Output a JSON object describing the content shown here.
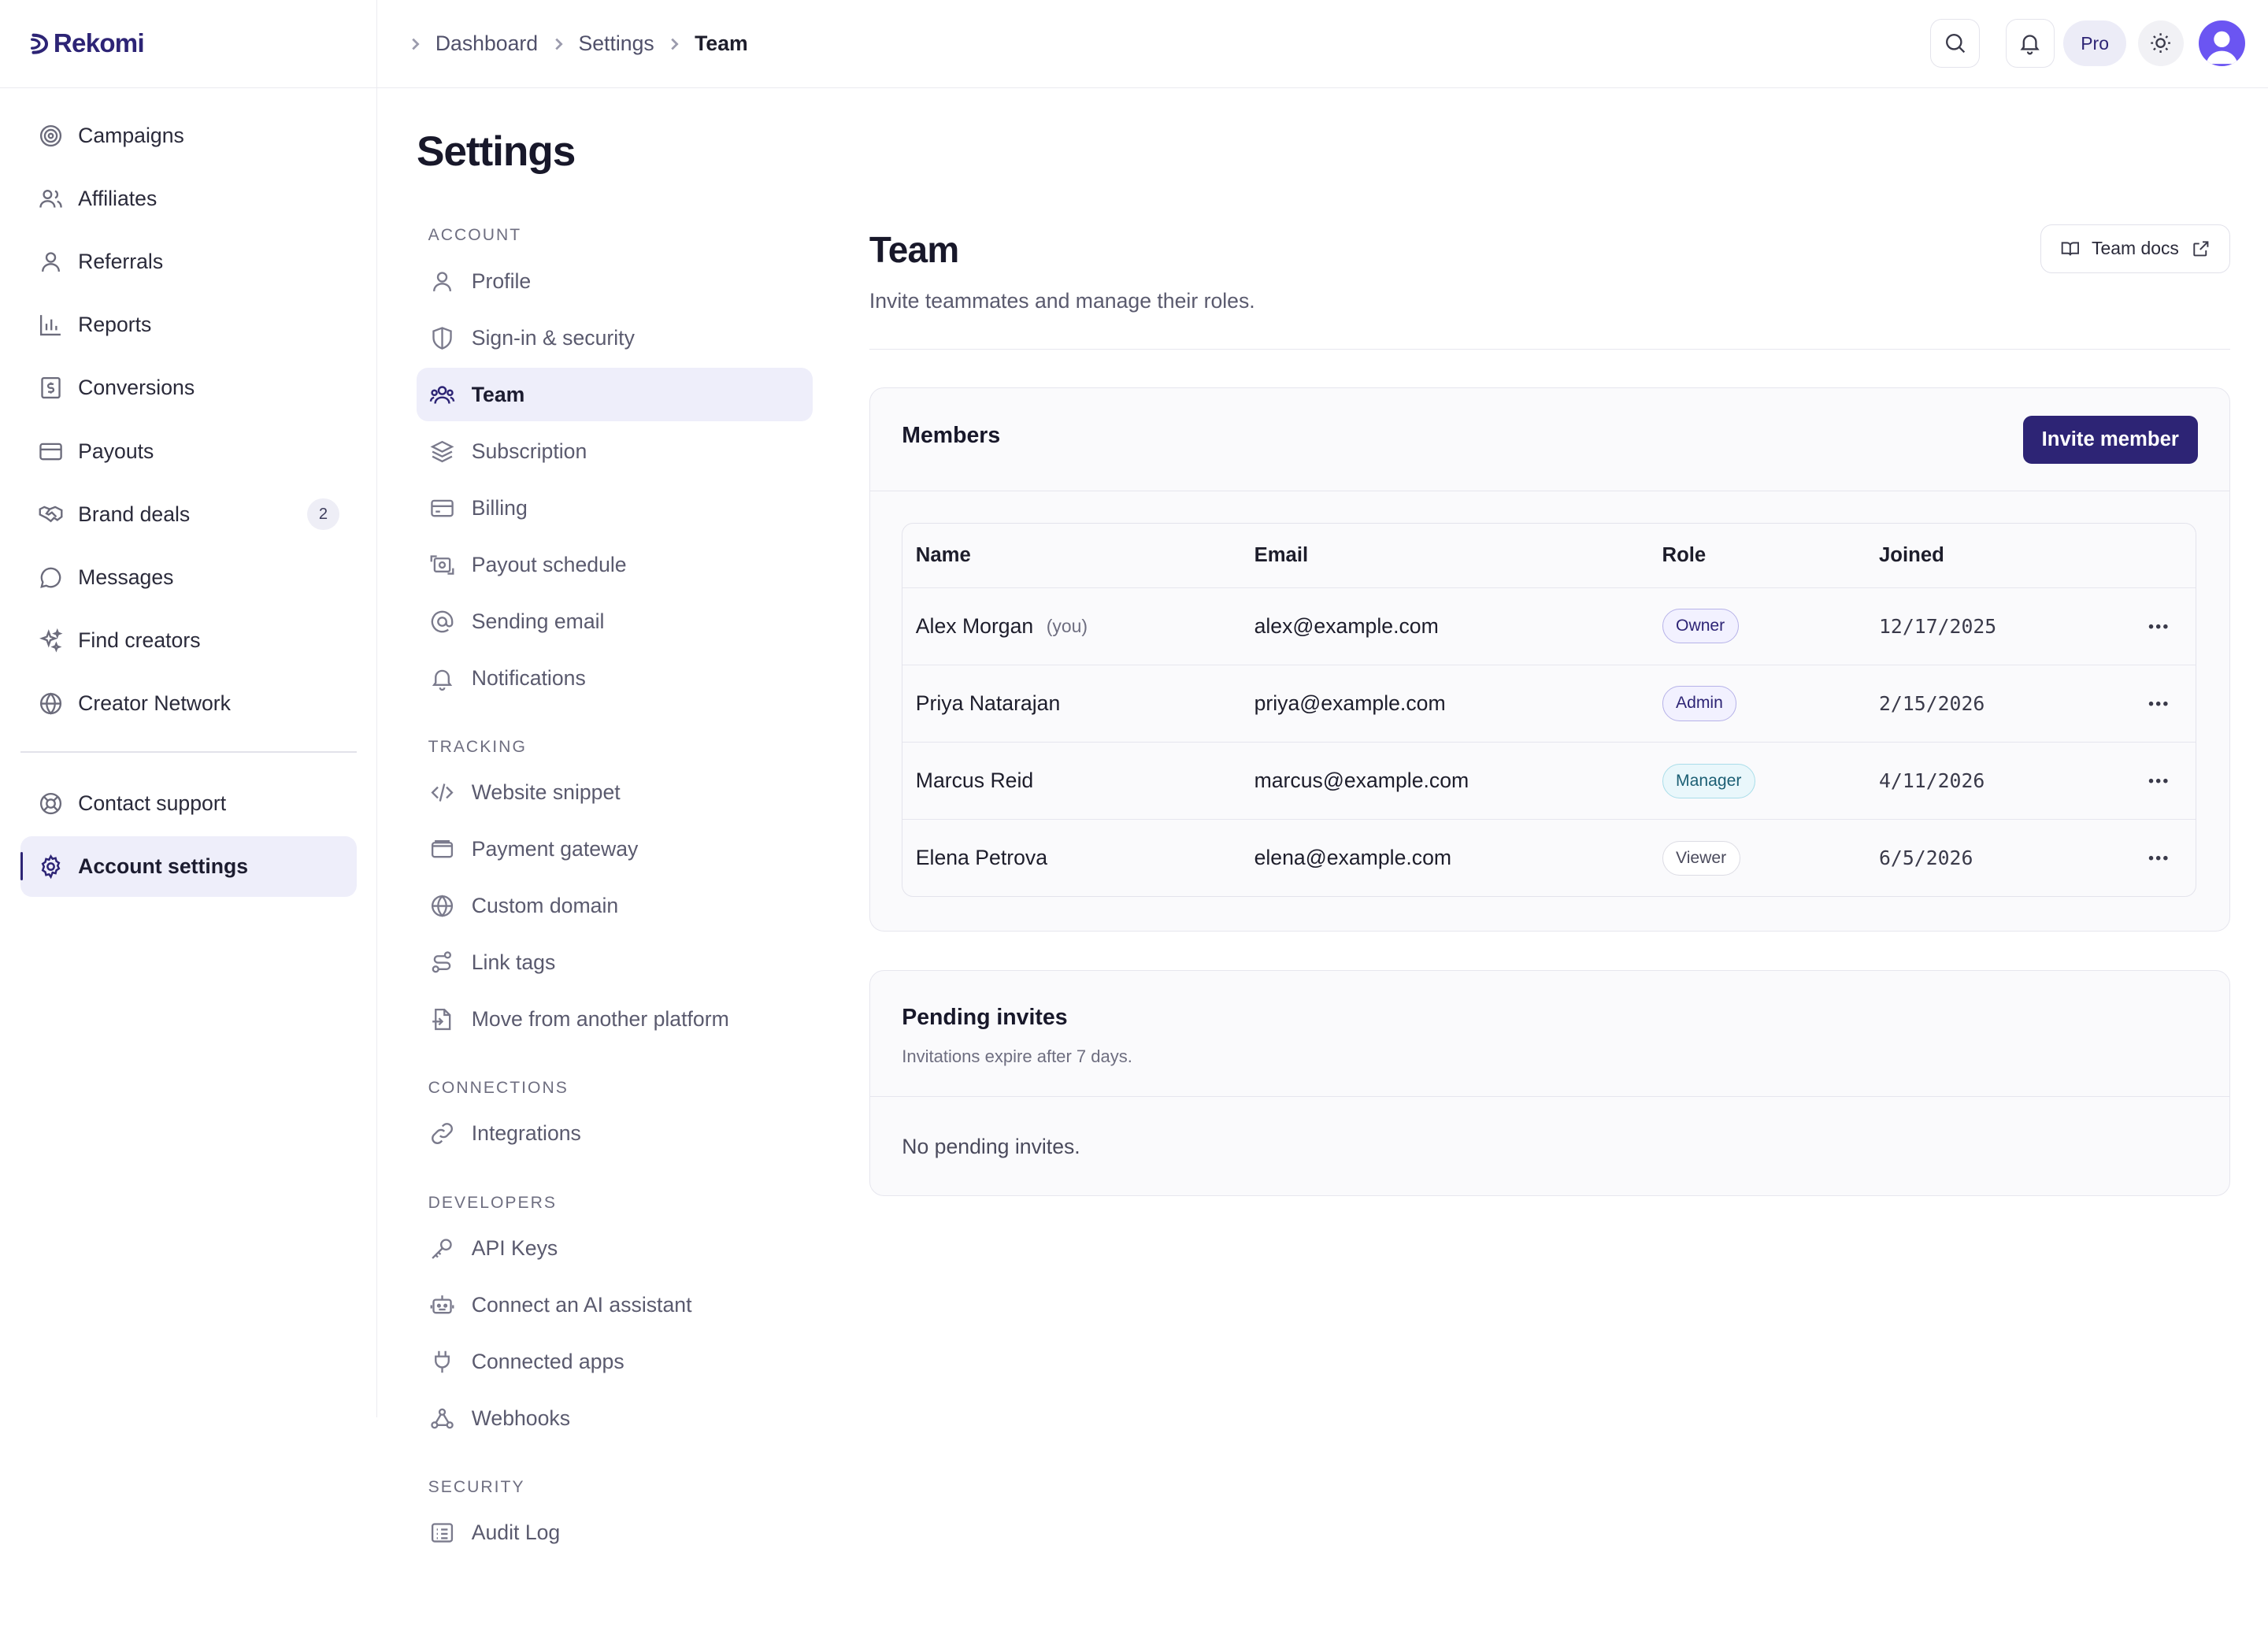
{
  "app": {
    "name": "Rekomi"
  },
  "breadcrumb": [
    "Dashboard",
    "Settings",
    "Team"
  ],
  "topbar": {
    "plan_label": "Pro"
  },
  "sidebar": {
    "items": [
      {
        "label": "Campaigns",
        "icon": "target-icon"
      },
      {
        "label": "Affiliates",
        "icon": "users-icon"
      },
      {
        "label": "Referrals",
        "icon": "user-icon"
      },
      {
        "label": "Reports",
        "icon": "bar-chart-icon"
      },
      {
        "label": "Conversions",
        "icon": "receipt-icon"
      },
      {
        "label": "Payouts",
        "icon": "credit-card-icon"
      },
      {
        "label": "Brand deals",
        "icon": "handshake-icon",
        "badge": "2"
      },
      {
        "label": "Messages",
        "icon": "message-icon"
      },
      {
        "label": "Find creators",
        "icon": "sparkles-icon"
      },
      {
        "label": "Creator Network",
        "icon": "globe-icon"
      }
    ],
    "footer_items": [
      {
        "label": "Contact support",
        "icon": "lifebuoy-icon"
      },
      {
        "label": "Account settings",
        "icon": "gear-icon",
        "active": true
      }
    ]
  },
  "page": {
    "title": "Settings"
  },
  "settings_nav": {
    "sections": [
      {
        "title": "ACCOUNT",
        "items": [
          "Profile",
          "Sign-in & security",
          "Team",
          "Subscription",
          "Billing",
          "Payout schedule",
          "Sending email",
          "Notifications"
        ]
      },
      {
        "title": "TRACKING",
        "items": [
          "Website snippet",
          "Payment gateway",
          "Custom domain",
          "Link tags",
          "Move from another platform"
        ]
      },
      {
        "title": "CONNECTIONS",
        "items": [
          "Integrations"
        ]
      },
      {
        "title": "DEVELOPERS",
        "items": [
          "API Keys",
          "Connect an AI assistant",
          "Connected apps",
          "Webhooks"
        ]
      },
      {
        "title": "SECURITY",
        "items": [
          "Audit Log"
        ]
      }
    ],
    "active": "Team"
  },
  "team": {
    "title": "Team",
    "subtitle": "Invite teammates and manage their roles.",
    "docs_label": "Team docs"
  },
  "members": {
    "title": "Members",
    "invite_label": "Invite member",
    "columns": [
      "Name",
      "Email",
      "Role",
      "Joined"
    ],
    "rows": [
      {
        "name": "Alex Morgan",
        "you": "(you)",
        "email": "alex@example.com",
        "role": "Owner",
        "joined": "12/17/2025"
      },
      {
        "name": "Priya Natarajan",
        "email": "priya@example.com",
        "role": "Admin",
        "joined": "2/15/2026"
      },
      {
        "name": "Marcus Reid",
        "email": "marcus@example.com",
        "role": "Manager",
        "joined": "4/11/2026"
      },
      {
        "name": "Elena Petrova",
        "email": "elena@example.com",
        "role": "Viewer",
        "joined": "6/5/2026"
      }
    ]
  },
  "pending": {
    "title": "Pending invites",
    "subtitle": "Invitations expire after 7 days.",
    "empty": "No pending invites."
  },
  "colors": {
    "brand": "#2d2475",
    "active_bg": "#eeeefa",
    "avatar": "#6b55f2"
  }
}
